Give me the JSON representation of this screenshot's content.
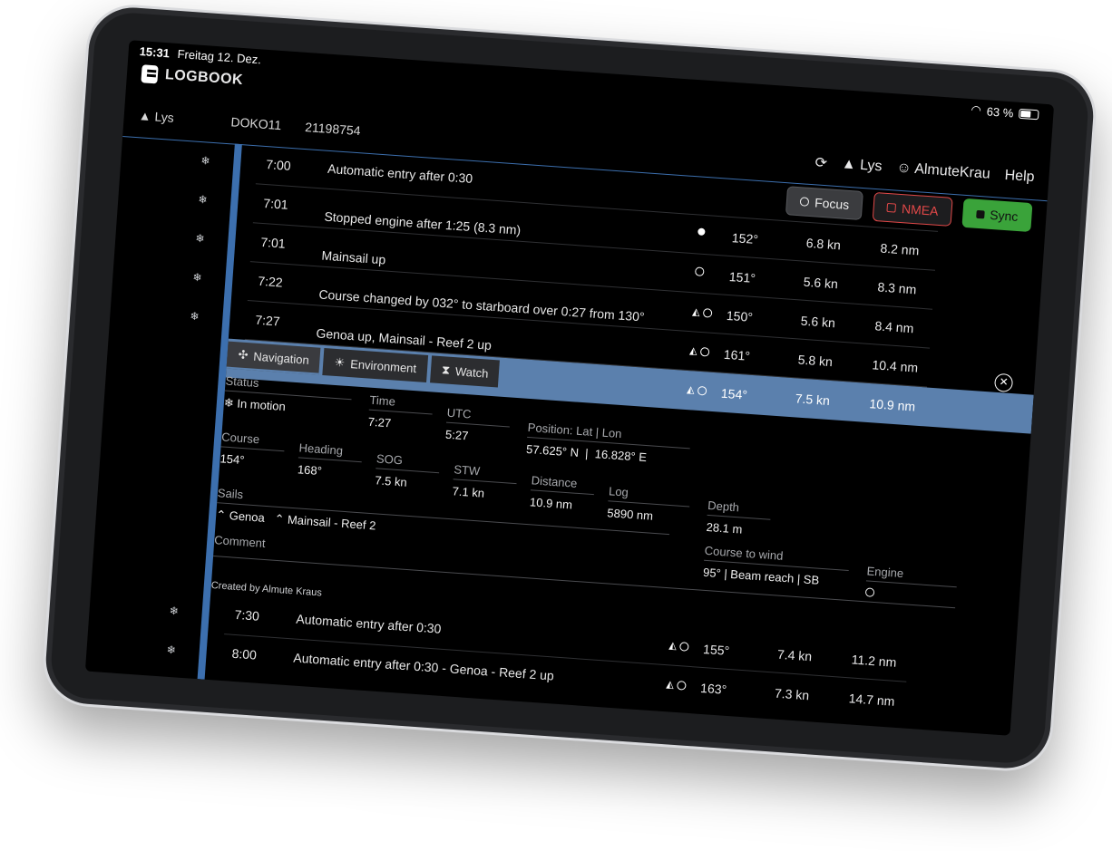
{
  "status_bar": {
    "time": "15:31",
    "date": "Freitag 12. Dez.",
    "battery": "63 %"
  },
  "brand": {
    "name": "LOGBOOK"
  },
  "header": {
    "boat": "Lys",
    "callsign": "DOKO11",
    "mmsi": "21198754",
    "nav": {
      "boat": "Lys",
      "user": "AlmuteKrau",
      "help": "Help"
    }
  },
  "actions": {
    "focus": "Focus",
    "nmea": "NMEA",
    "sync": "Sync"
  },
  "entries": [
    {
      "time": "7:00",
      "desc": "Automatic entry after 0:30",
      "course": "",
      "speed": "",
      "distance": ""
    },
    {
      "time": "7:01",
      "desc": "Stopped engine after 1:25 (8.3 nm)",
      "course": "152°",
      "speed": "6.8 kn",
      "distance": "8.2 nm"
    },
    {
      "time": "7:01",
      "desc": "Mainsail up",
      "course": "151°",
      "speed": "5.6 kn",
      "distance": "8.3 nm"
    },
    {
      "time": "7:22",
      "desc": "Course changed by 032° to starboard over 0:27 from 130°",
      "course": "150°",
      "speed": "5.6 kn",
      "distance": "8.4 nm"
    },
    {
      "time": "7:27",
      "desc": "Genoa up, Mainsail - Reef 2 up",
      "course": "161°",
      "speed": "5.8 kn",
      "distance": "10.4 nm"
    },
    {
      "time": "",
      "desc": "",
      "course": "154°",
      "speed": "7.5 kn",
      "distance": "10.9 nm"
    }
  ],
  "tabs": {
    "navigation": "Navigation",
    "environment": "Environment",
    "watch": "Watch"
  },
  "detail": {
    "status_label": "Status",
    "status_value": "In motion",
    "time_label": "Time",
    "time_value": "7:27",
    "utc_label": "UTC",
    "utc_value": "5:27",
    "position_label": "Position: Lat | Lon",
    "lat": "57.625° N",
    "lon": "16.828° E",
    "course_label": "Course",
    "course_value": "154°",
    "heading_label": "Heading",
    "heading_value": "168°",
    "sog_label": "SOG",
    "sog_value": "7.5 kn",
    "stw_label": "STW",
    "stw_value": "7.1 kn",
    "distance_label": "Distance",
    "distance_value": "10.9 nm",
    "log_label": "Log",
    "log_value": "5890 nm",
    "depth_label": "Depth",
    "depth_value": "28.1 m",
    "sails_label": "Sails",
    "sail1": "Genoa",
    "sail2": "Mainsail - Reef 2",
    "ctw_label": "Course to wind",
    "ctw_value": "95° | Beam reach | SB",
    "engine_label": "Engine",
    "comment_label": "Comment"
  },
  "created_by": "Created by Almute Kraus",
  "later_entries": [
    {
      "time": "7:30",
      "desc": "Automatic entry after 0:30",
      "course": "155°",
      "speed": "7.4 kn",
      "distance": "11.2 nm"
    },
    {
      "time": "8:00",
      "desc": "Automatic entry after 0:30 - Genoa - Reef 2 up",
      "course": "163°",
      "speed": "7.3 kn",
      "distance": "14.7 nm"
    }
  ]
}
